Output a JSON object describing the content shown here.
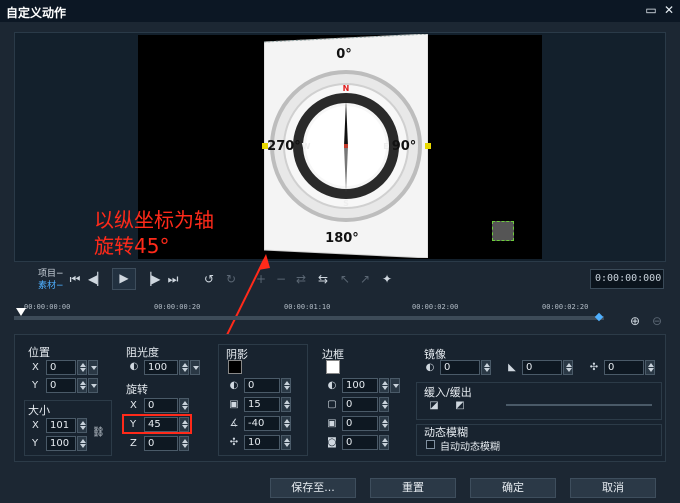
{
  "window": {
    "title": "自定义动作",
    "maximize_icon": "maximize-icon",
    "close_icon": "close-icon"
  },
  "preview": {
    "compass": {
      "n": "N",
      "s": "S",
      "e": "E",
      "w": "W",
      "deg_top": "0°",
      "deg_right": "90°",
      "deg_left": "270°",
      "deg_bottom": "180°"
    },
    "annotation_line1": "以纵坐标为轴",
    "annotation_line2": "旋转45°",
    "annotation_color": "#ff2a1a"
  },
  "playback": {
    "project_label": "项目−",
    "clip_label": "素材−",
    "timecode": "0:00:00:000"
  },
  "timeline": {
    "ticks": [
      "00:00:00:00",
      "00:00:00:20",
      "00:00:01:10",
      "00:00:02:00",
      "00:00:02:20"
    ]
  },
  "position": {
    "label": "位置",
    "x_label": "X",
    "x": "0",
    "y_label": "Y",
    "y": "0"
  },
  "size": {
    "label": "大小",
    "x_label": "X",
    "x": "101",
    "y_label": "Y",
    "y": "100"
  },
  "opacity": {
    "label": "阻光度",
    "value": "100"
  },
  "rotation": {
    "label": "旋转",
    "x_label": "X",
    "x": "0",
    "y_label": "Y",
    "y": "45",
    "z_label": "Z",
    "z": "0"
  },
  "shadow": {
    "label": "阴影",
    "v1": "0",
    "v2": "15",
    "v3": "-40",
    "v4": "10"
  },
  "border": {
    "label": "边框",
    "v1": "100",
    "v2": "0",
    "v3": "0",
    "v4": "0"
  },
  "mirror": {
    "label": "镜像",
    "v1": "0",
    "v2": "0",
    "v3": "0"
  },
  "ease": {
    "label": "缓入/缓出"
  },
  "motion_blur": {
    "label": "动态模糊",
    "checkbox_label": "自动动态模糊"
  },
  "footer": {
    "save_to": "保存至...",
    "reset": "重置",
    "ok": "确定",
    "cancel": "取消"
  }
}
